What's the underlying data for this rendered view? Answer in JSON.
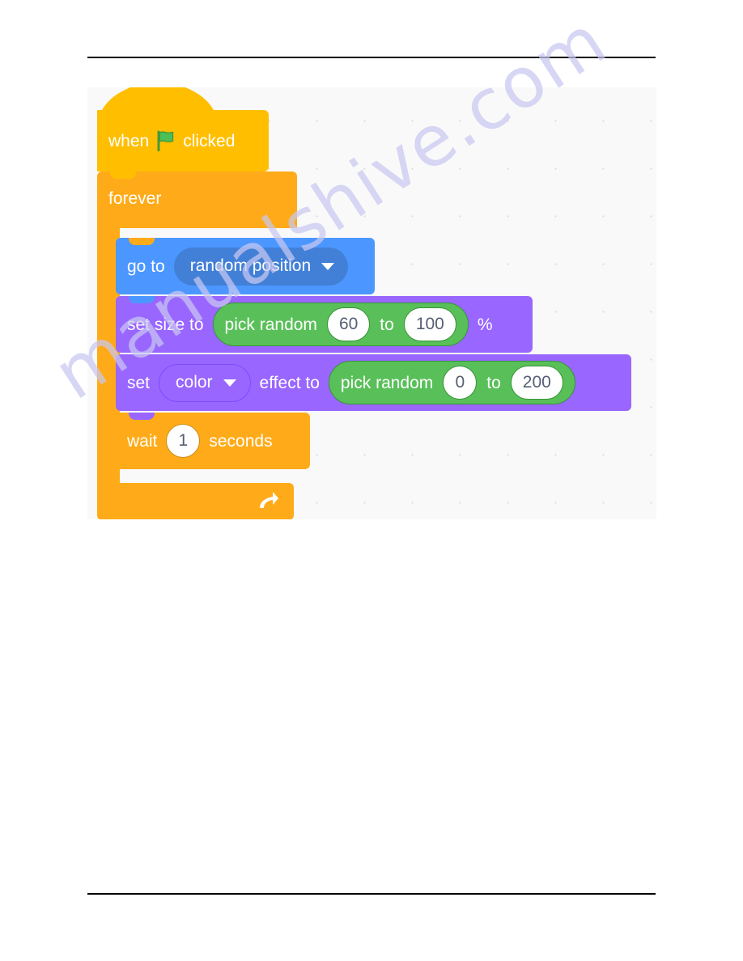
{
  "page": {
    "watermark": "manualshive.com",
    "background": "#ffffff",
    "rule_color": "#000000"
  },
  "canvas": {
    "name": "scratch-code-canvas",
    "background": "#f9f9f9",
    "dot_color": "#e3e3e3"
  },
  "palette": {
    "events_yellow": "#ffbf00",
    "control_orange": "#ffab19",
    "motion_blue": "#4c97ff",
    "motion_blue_dark": "#4280d7",
    "looks_purple": "#9966ff",
    "operators_green": "#59c059",
    "input_white": "#ffffff",
    "input_text": "#575e75"
  },
  "script": {
    "hat": {
      "word_when": "when",
      "icon": "green-flag-icon",
      "word_clicked": "clicked"
    },
    "forever": {
      "label": "forever",
      "loop_icon": "loop-arrow-icon"
    },
    "go_to": {
      "label": "go to",
      "dropdown_value": "random position",
      "dropdown_icon": "chevron-down-icon"
    },
    "set_size": {
      "label": "set size to",
      "operator_label": "pick random",
      "from_value": "60",
      "to_word": "to",
      "to_value": "100",
      "unit": "%"
    },
    "set_effect": {
      "label": "set",
      "dropdown_value": "color",
      "dropdown_icon": "chevron-down-icon",
      "label_2": "effect to",
      "operator_label": "pick random",
      "from_value": "0",
      "to_word": "to",
      "to_value": "200"
    },
    "wait": {
      "label": "wait",
      "value": "1",
      "unit": "seconds"
    }
  }
}
